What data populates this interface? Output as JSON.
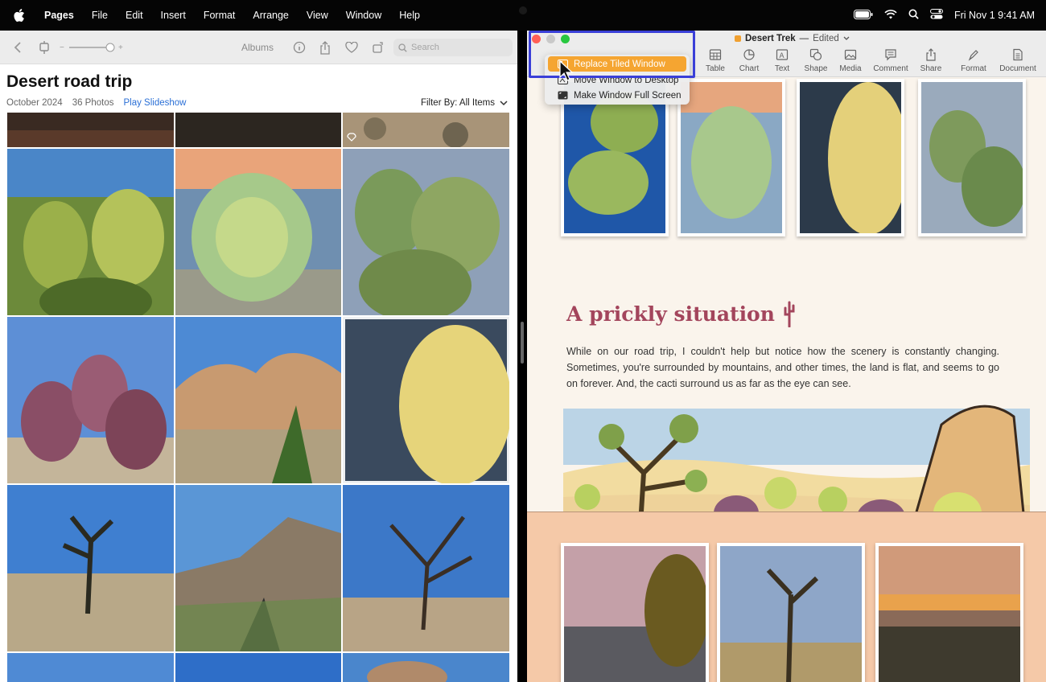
{
  "menubar": {
    "app_name": "Pages",
    "items": [
      "File",
      "Edit",
      "Insert",
      "Format",
      "Arrange",
      "View",
      "Window",
      "Help"
    ],
    "clock": "Fri Nov 1  9:41 AM"
  },
  "photos": {
    "toolbar_title": "Albums",
    "search_placeholder": "Search",
    "album_title": "Desert road trip",
    "date": "October 2024",
    "count": "36 Photos",
    "slideshow_label": "Play Slideshow",
    "filter_label": "Filter By: All Items"
  },
  "pages": {
    "doc_name": "Desert Trek",
    "edited": "Edited",
    "toolbar": [
      {
        "label": "Table",
        "icon": "table-icon"
      },
      {
        "label": "Chart",
        "icon": "chart-icon"
      },
      {
        "label": "Text",
        "icon": "text-icon"
      },
      {
        "label": "Shape",
        "icon": "shape-icon"
      },
      {
        "label": "Media",
        "icon": "media-icon"
      },
      {
        "label": "Comment",
        "icon": "comment-icon"
      },
      {
        "label": "Share",
        "icon": "share-icon"
      },
      {
        "label": "Format",
        "icon": "format-icon"
      },
      {
        "label": "Document",
        "icon": "document-icon"
      }
    ],
    "heading": "A prickly situation",
    "body": "While on our road trip, I couldn't help but notice how the scenery is constantly changing. Sometimes, you're surrounded by mountains, and other times, the land is flat, and seems to go on forever. And, the cacti surround us as far as the eye can see."
  },
  "window_menu": {
    "items": [
      "Replace Tiled Window",
      "Move Window to Desktop",
      "Make Window Full Screen"
    ],
    "selected_index": 0
  },
  "colors": {
    "heading": "#a3455c",
    "menu_highlight": "#f5a531",
    "focus_box": "#3a3fd8",
    "link": "#2a6fd6"
  }
}
